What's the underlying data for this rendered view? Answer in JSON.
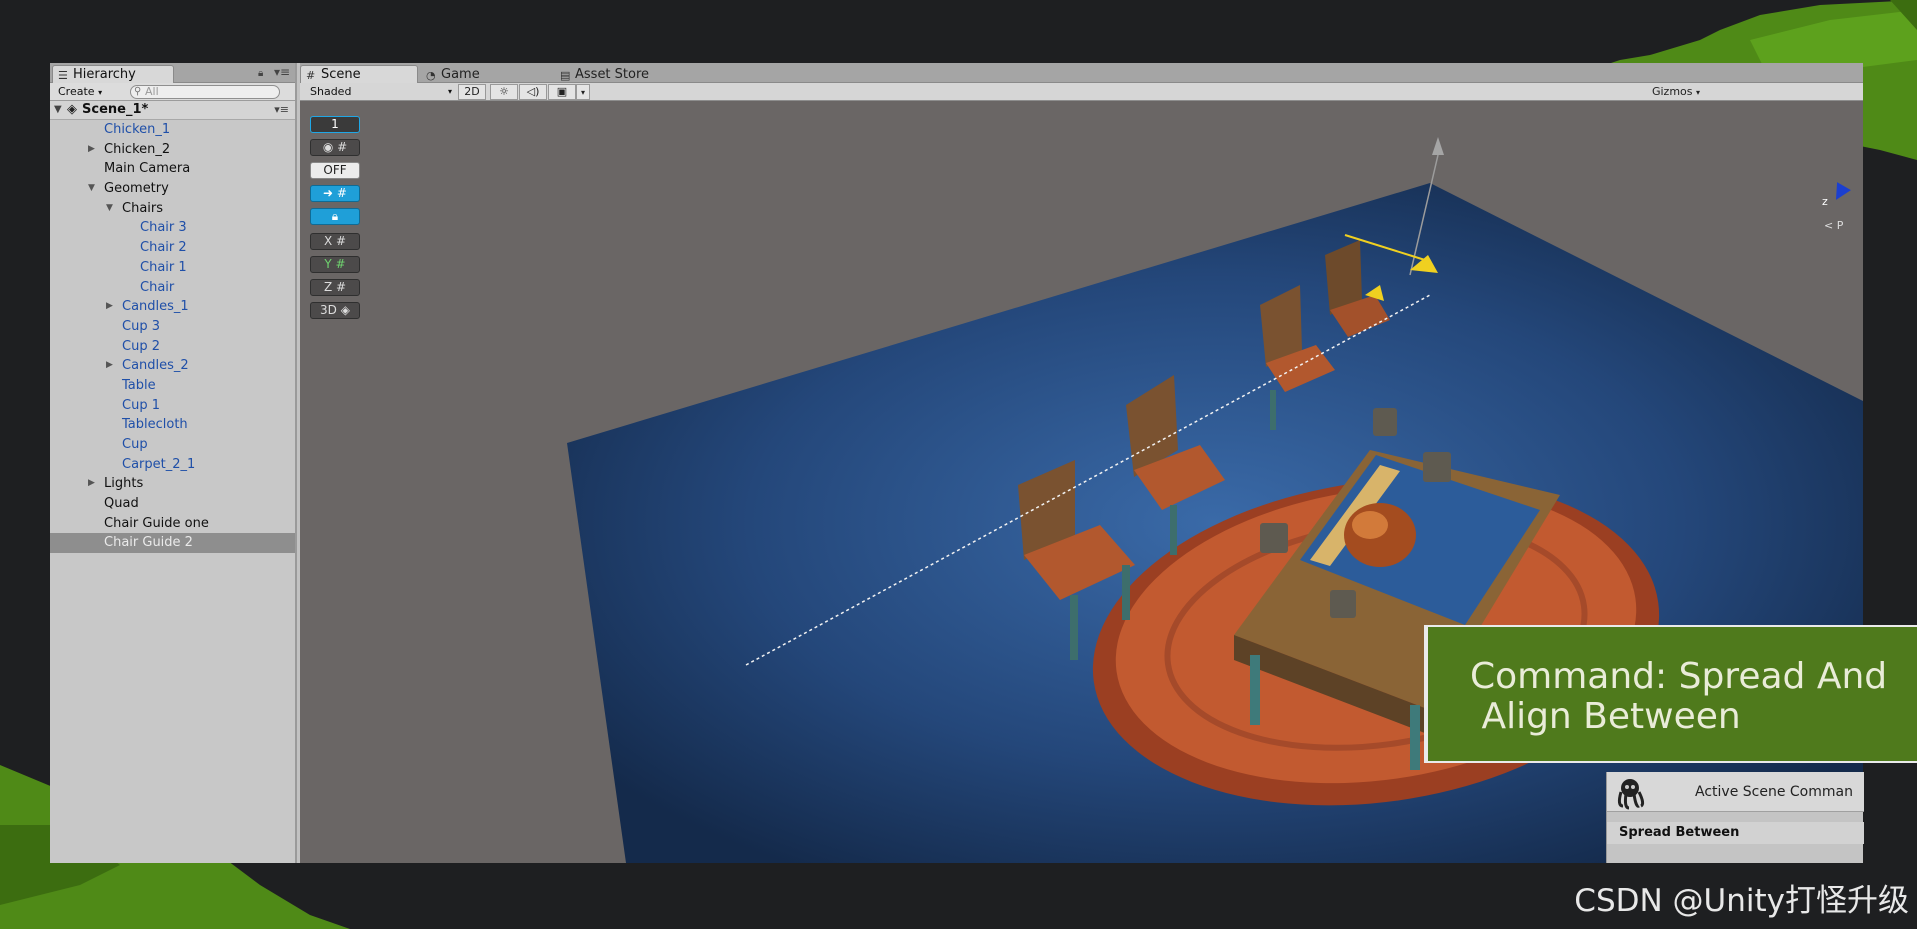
{
  "hierarchy": {
    "tab_label": "Hierarchy",
    "create_label": "Create",
    "search_placeholder": "All",
    "scene_name": "Scene_1*",
    "items": [
      {
        "label": "Chicken_1",
        "level": 1,
        "blue": true,
        "arrow": ""
      },
      {
        "label": "Chicken_2",
        "level": 1,
        "blue": false,
        "arrow": "right"
      },
      {
        "label": "Main Camera",
        "level": 1,
        "blue": false,
        "arrow": ""
      },
      {
        "label": "Geometry",
        "level": 1,
        "blue": false,
        "arrow": "down"
      },
      {
        "label": "Chairs",
        "level": 2,
        "blue": false,
        "arrow": "down"
      },
      {
        "label": "Chair 3",
        "level": 3,
        "blue": true,
        "arrow": ""
      },
      {
        "label": "Chair 2",
        "level": 3,
        "blue": true,
        "arrow": ""
      },
      {
        "label": "Chair 1",
        "level": 3,
        "blue": true,
        "arrow": ""
      },
      {
        "label": "Chair",
        "level": 3,
        "blue": true,
        "arrow": ""
      },
      {
        "label": "Candles_1",
        "level": 2,
        "blue": true,
        "arrow": "right"
      },
      {
        "label": "Cup 3",
        "level": 2,
        "blue": true,
        "arrow": ""
      },
      {
        "label": "Cup 2",
        "level": 2,
        "blue": true,
        "arrow": ""
      },
      {
        "label": "Candles_2",
        "level": 2,
        "blue": true,
        "arrow": "right"
      },
      {
        "label": "Table",
        "level": 2,
        "blue": true,
        "arrow": ""
      },
      {
        "label": "Cup 1",
        "level": 2,
        "blue": true,
        "arrow": ""
      },
      {
        "label": "Tablecloth",
        "level": 2,
        "blue": true,
        "arrow": ""
      },
      {
        "label": "Cup",
        "level": 2,
        "blue": true,
        "arrow": ""
      },
      {
        "label": "Carpet_2_1",
        "level": 2,
        "blue": true,
        "arrow": ""
      },
      {
        "label": "Lights",
        "level": 1,
        "blue": false,
        "arrow": "right"
      },
      {
        "label": "Quad",
        "level": 1,
        "blue": false,
        "arrow": ""
      },
      {
        "label": "Chair Guide one",
        "level": 1,
        "blue": false,
        "arrow": ""
      },
      {
        "label": "Chair Guide 2",
        "level": 1,
        "blue": false,
        "arrow": "",
        "selected": true
      }
    ]
  },
  "tabs": {
    "scene": "Scene",
    "game": "Game",
    "asset_store": "Asset Store"
  },
  "scene_toolbar": {
    "shading": "Shaded",
    "mode_2d": "2D",
    "gizmos": "Gizmos"
  },
  "scene_tools": {
    "counter": "1",
    "off_label": "OFF",
    "x_label": "X",
    "y_label": "Y",
    "z_label": "Z",
    "d3_label": "3D"
  },
  "axis_gizmo": {
    "z_label": "z",
    "persp_label": "< P"
  },
  "caption": {
    "line1": "Command: Spread And",
    "line2": " Align Between"
  },
  "active_scene_commands": {
    "title": "Active Scene Comman",
    "item": "Spread Between"
  },
  "watermark": "CSDN @Unity打怪升级",
  "colors": {
    "caption_bg": "#4f7a1c",
    "hierarchy_link_blue": "#1f4fa8",
    "floor_blue": "#1f3f6e",
    "carpet_orange": "#b5532b",
    "tool_blue": "#1f9fd8"
  }
}
